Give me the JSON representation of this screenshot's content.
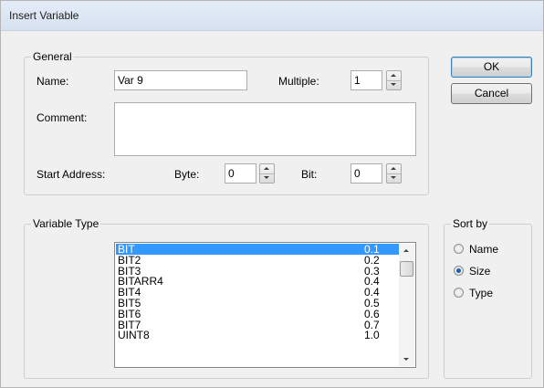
{
  "window": {
    "title": "Insert Variable"
  },
  "general": {
    "legend": "General",
    "name_label": "Name:",
    "name_value": "Var 9",
    "multiple_label": "Multiple:",
    "multiple_value": "1",
    "comment_label": "Comment:",
    "comment_value": "",
    "start_address_label": "Start Address:",
    "byte_label": "Byte:",
    "byte_value": "0",
    "bit_label": "Bit:",
    "bit_value": "0"
  },
  "buttons": {
    "ok": "OK",
    "cancel": "Cancel"
  },
  "variable_type": {
    "legend": "Variable Type",
    "items": [
      {
        "name": "BIT",
        "size": "0.1",
        "selected": true
      },
      {
        "name": "BIT2",
        "size": "0.2"
      },
      {
        "name": "BIT3",
        "size": "0.3"
      },
      {
        "name": "BITARR4",
        "size": "0.4"
      },
      {
        "name": "BIT4",
        "size": "0.4"
      },
      {
        "name": "BIT5",
        "size": "0.5"
      },
      {
        "name": "BIT6",
        "size": "0.6"
      },
      {
        "name": "BIT7",
        "size": "0.7"
      },
      {
        "name": "UINT8",
        "size": "1.0"
      }
    ]
  },
  "sort_by": {
    "legend": "Sort by",
    "options": [
      {
        "label": "Name",
        "checked": false
      },
      {
        "label": "Size",
        "checked": true
      },
      {
        "label": "Type",
        "checked": false
      }
    ]
  }
}
